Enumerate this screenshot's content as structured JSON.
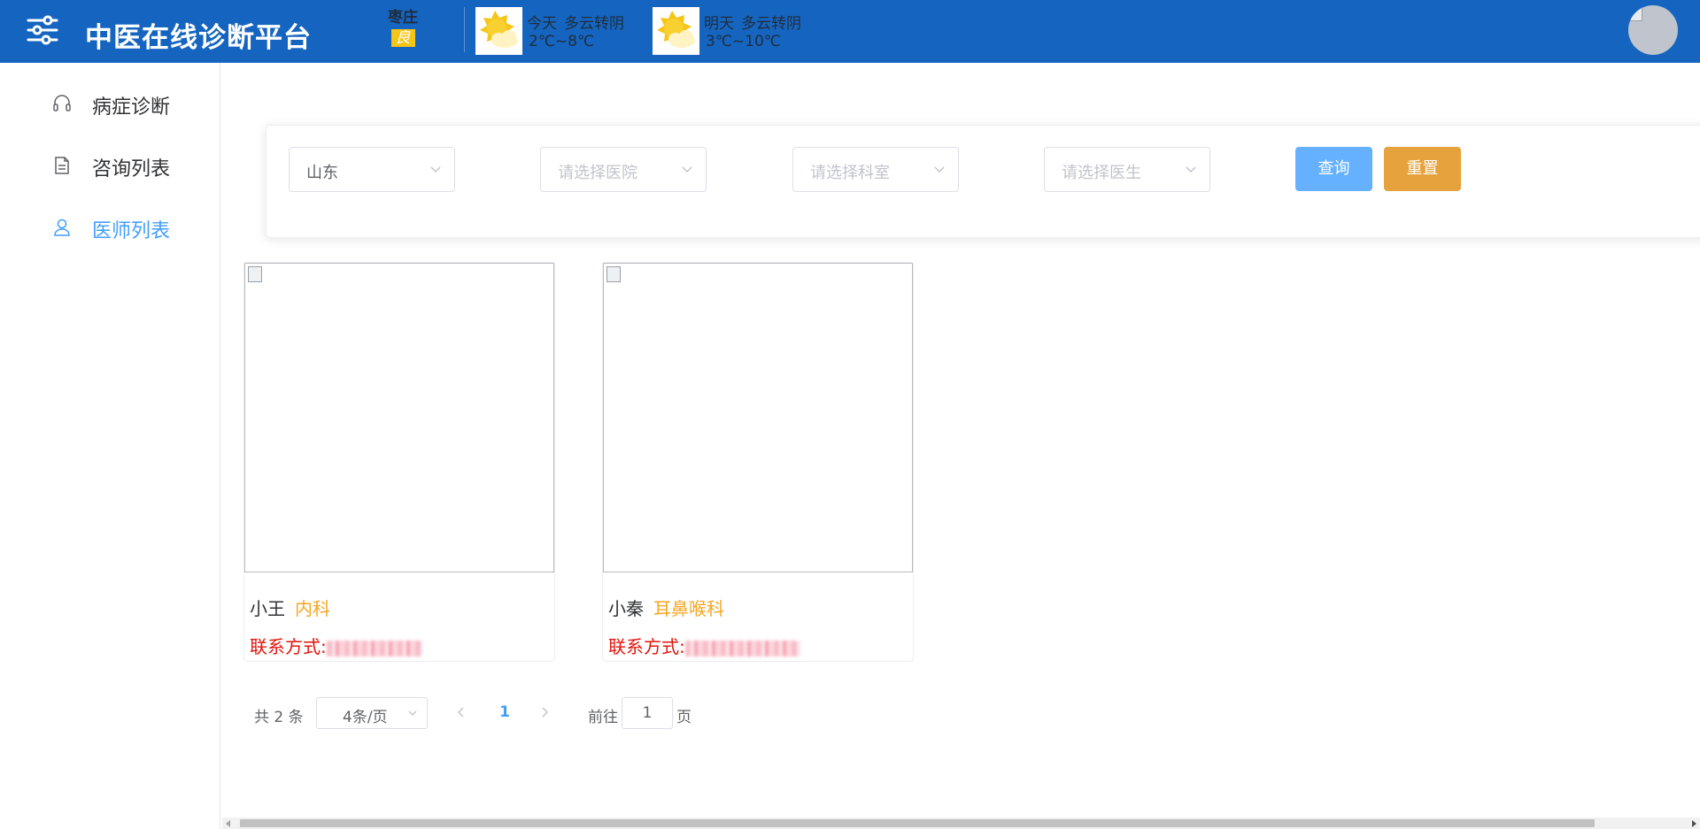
{
  "header": {
    "title": "中医在线诊断平台",
    "menu_icon": "sliders-icon",
    "city": "枣庄",
    "aqi": "良",
    "weather": [
      {
        "day": "今天",
        "condition": "多云转阴",
        "temp": "2℃~8℃",
        "icon": "partly-cloudy-icon"
      },
      {
        "day": "明天",
        "condition": "多云转阴",
        "temp": "3℃~10℃",
        "icon": "partly-cloudy-icon"
      }
    ],
    "colors": {
      "bar": "#1565c0"
    }
  },
  "sidebar": {
    "items": [
      {
        "label": "病症诊断",
        "icon": "headset-icon",
        "active": false
      },
      {
        "label": "咨询列表",
        "icon": "document-icon",
        "active": false
      },
      {
        "label": "医师列表",
        "icon": "user-icon",
        "active": true
      }
    ],
    "active_color": "#409eff"
  },
  "filters": {
    "province": {
      "value": "山东",
      "placeholder": ""
    },
    "hospital": {
      "placeholder": "请选择医院"
    },
    "department": {
      "placeholder": "请选择科室"
    },
    "doctor": {
      "placeholder": "请选择医生"
    },
    "query_label": "查询",
    "reset_label": "重置"
  },
  "doctors": [
    {
      "name": "小王",
      "department": "内科",
      "contact_label": "联系方式:"
    },
    {
      "name": "小秦",
      "department": "耳鼻喉科",
      "contact_label": "联系方式:"
    }
  ],
  "pagination": {
    "total_text": "共 2 条",
    "page_size": "4条/页",
    "current_page": "1",
    "goto_label": "前往",
    "goto_value": "1",
    "page_unit": "页"
  }
}
